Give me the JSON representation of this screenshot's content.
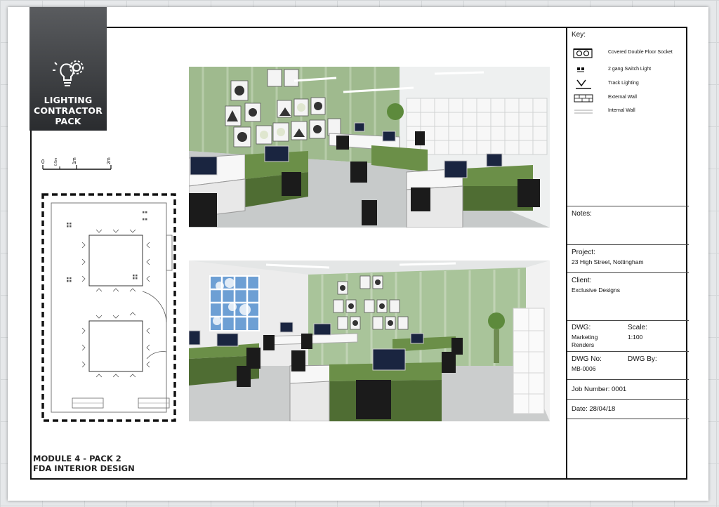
{
  "logo": {
    "line1": "LIGHTING",
    "line2": "CONTRACTOR",
    "line3": "PACK",
    "icon": "lightbulb-gear-icon"
  },
  "scale_bar": {
    "label_0": "0",
    "label_half": "0.5m",
    "label_1": "1m",
    "label_2": "2m"
  },
  "renders": {
    "top": "office-render-view-1",
    "bottom": "office-render-view-2"
  },
  "key": {
    "title": "Key:",
    "items": [
      {
        "icon": "double-floor-socket-icon",
        "label": "Covered Double Floor Socket"
      },
      {
        "icon": "switch-light-icon",
        "label": "2 gang Switch Light"
      },
      {
        "icon": "track-lighting-icon",
        "label": "Track Lighting"
      },
      {
        "icon": "external-wall-icon",
        "label": "External Wall"
      },
      {
        "icon": "internal-wall-icon",
        "label": "Internal Wall"
      }
    ]
  },
  "notes": {
    "label": "Notes:"
  },
  "project": {
    "label": "Project:",
    "value": "23 High Street, Nottingham"
  },
  "client": {
    "label": "Client:",
    "value": "Exclusive Designs"
  },
  "dwg": {
    "label": "DWG:",
    "value_line1": "Marketing",
    "value_line2": "Renders",
    "scale_label": "Scale:",
    "scale_value": "1:100",
    "no_label": "DWG No:",
    "no_value": "MB-0006",
    "by_label": "DWG By:"
  },
  "job": {
    "label": "Job Number: 0001"
  },
  "date": {
    "label": "Date: 28/04/18"
  },
  "footer": {
    "line1": "MODULE 4 - PACK 2",
    "line2": "FDA INTERIOR DESIGN"
  },
  "colors": {
    "desk_green": "#6b8f48",
    "wall_green": "#a9c49a",
    "logo_bg": "#3b3d40"
  }
}
